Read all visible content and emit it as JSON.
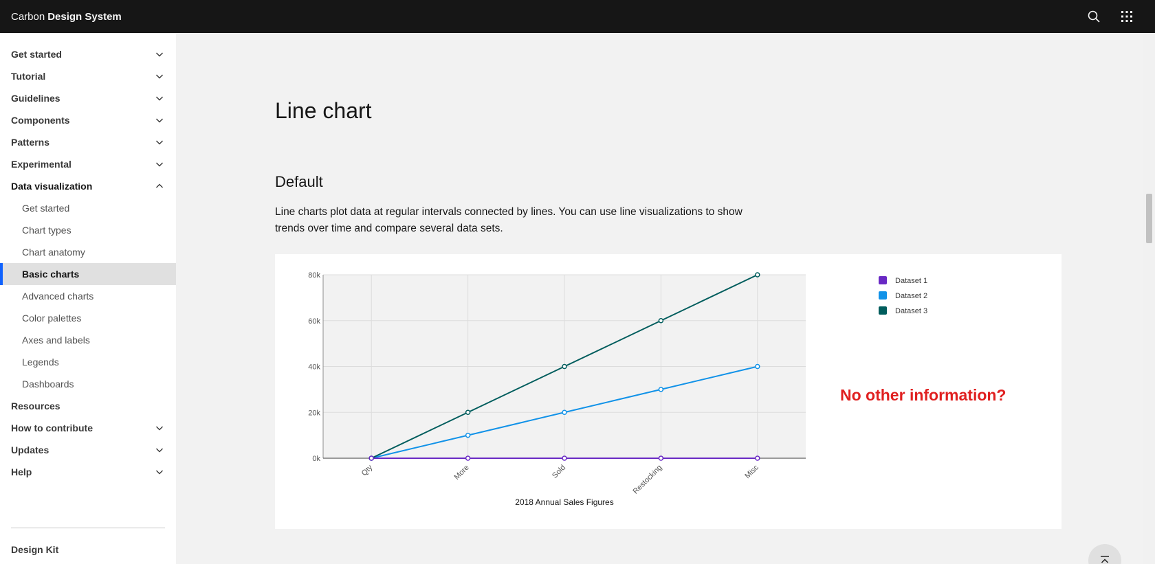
{
  "header": {
    "brand_prefix": "Carbon",
    "brand_name": "Design System",
    "search_icon": "search-icon",
    "switcher_icon": "app-switcher-icon"
  },
  "sidebar": {
    "items": [
      {
        "label": "Get started",
        "expanded": false
      },
      {
        "label": "Tutorial",
        "expanded": false
      },
      {
        "label": "Guidelines",
        "expanded": false
      },
      {
        "label": "Components",
        "expanded": false
      },
      {
        "label": "Patterns",
        "expanded": false
      },
      {
        "label": "Experimental",
        "expanded": false
      },
      {
        "label": "Data visualization",
        "expanded": true
      }
    ],
    "subitems": [
      {
        "label": "Get started"
      },
      {
        "label": "Chart types"
      },
      {
        "label": "Chart anatomy"
      },
      {
        "label": "Basic charts",
        "active": true
      },
      {
        "label": "Advanced charts"
      },
      {
        "label": "Color palettes"
      },
      {
        "label": "Axes and labels"
      },
      {
        "label": "Legends"
      },
      {
        "label": "Dashboards"
      }
    ],
    "items_after": [
      {
        "label": "Resources"
      },
      {
        "label": "How to contribute"
      },
      {
        "label": "Updates"
      },
      {
        "label": "Help"
      }
    ],
    "footer_label": "Design Kit"
  },
  "main": {
    "title": "Line chart",
    "section_title": "Default",
    "section_desc": "Line charts plot data at regular intervals connected by lines. You can use line visualizations to show trends over time and compare several data sets."
  },
  "annotation": "No other information?",
  "chart_data": {
    "type": "line",
    "categories": [
      "Qty",
      "More",
      "Sold",
      "Restocking",
      "Misc"
    ],
    "series": [
      {
        "name": "Dataset 1",
        "color": "#6929c4",
        "values": [
          0,
          0,
          0,
          0,
          0
        ]
      },
      {
        "name": "Dataset 2",
        "color": "#1192e8",
        "values": [
          0,
          10000,
          20000,
          30000,
          40000
        ]
      },
      {
        "name": "Dataset 3",
        "color": "#005d5d",
        "values": [
          0,
          20000,
          40000,
          60000,
          80000
        ]
      }
    ],
    "yticks": [
      "0k",
      "20k",
      "40k",
      "60k",
      "80k"
    ],
    "ylim": [
      0,
      80000
    ],
    "xlabel": "2018 Annual Sales Figures",
    "ylabel": "",
    "grid": true,
    "legend_position": "right"
  }
}
